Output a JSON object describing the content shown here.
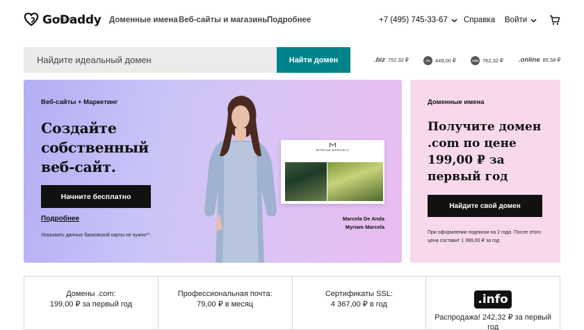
{
  "header": {
    "logo_text": "GoDaddy",
    "logo_subtext": "Россия",
    "nav": [
      "Доменные имена",
      "Веб-сайты и магазины",
      "Подробнее"
    ],
    "phone": "+7 (495) 745-33-67",
    "help": "Справка",
    "login": "Войти"
  },
  "search": {
    "placeholder": "Найдите идеальный домен",
    "button": "Найти домен"
  },
  "tlds": [
    {
      "name": ".biz",
      "price": "752,32 ₽"
    },
    {
      "name": "icu",
      "price": "449,00 ₽"
    },
    {
      "name": "club",
      "price": "762,32 ₽"
    },
    {
      "name": ".online",
      "price": "85,58 ₽"
    }
  ],
  "hero": {
    "kicker": "Веб-сайты + Маркетинг",
    "title": "Создайте собственный веб-сайт.",
    "button": "Начните бесплатно",
    "link": "Подробнее",
    "note": "Указывать данные банковской карты не нужно**.",
    "site_brand": "MYRIAM MARCELA",
    "caption_line1": "Marcela De Anda",
    "caption_line2": "Myriam Marcela"
  },
  "promo": {
    "kicker": "Доменные имена",
    "title": "Получите домен .com по цене 199,00 ₽ за первый год",
    "button": "Найдите свой домен",
    "note": "При оформлении подписки на 2 года. После этого цена составит 1 399,00 ₽ за год"
  },
  "cards": [
    {
      "title": "Домены .com:",
      "price": "199,00 ₽ за первый год"
    },
    {
      "title": "Профессиональная почта:",
      "price": "79,00 ₽ в месяц"
    },
    {
      "title": "Сертификаты SSL:",
      "price": "4 367,00 ₽ в год"
    }
  ],
  "info_card": {
    "logo": ".info",
    "sale_line1": "Распродажа! 242,32 ₽ за первый",
    "sale_line2": "год"
  },
  "colors": {
    "accent": "#00848c",
    "promo_bg": "#f8d9ec",
    "hero_gradient_start": "#b4aef4",
    "hero_gradient_end": "#eabdf1"
  },
  "icons": [
    "godaddy-logo-icon",
    "chevron-down-icon",
    "cart-icon"
  ]
}
